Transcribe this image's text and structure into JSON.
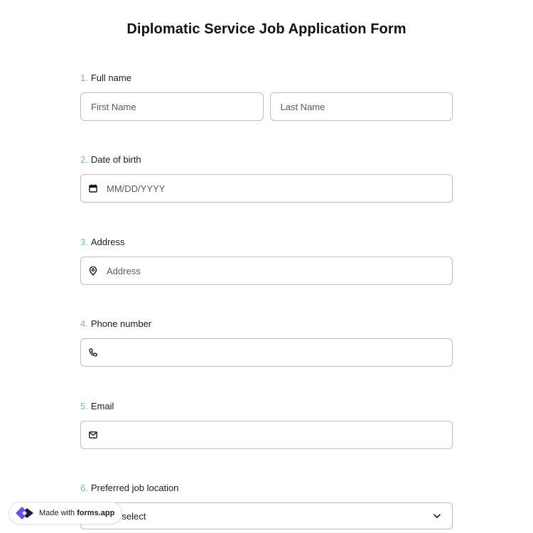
{
  "form": {
    "title": "Diplomatic Service Job Application Form"
  },
  "questions": [
    {
      "number": "1.",
      "label": "Full name",
      "fields": [
        {
          "placeholder": "First Name"
        },
        {
          "placeholder": "Last Name"
        }
      ]
    },
    {
      "number": "2.",
      "label": "Date of birth",
      "icon": "calendar-icon",
      "placeholder": "MM/DD/YYYY"
    },
    {
      "number": "3.",
      "label": "Address",
      "icon": "location-pin-icon",
      "placeholder": "Address"
    },
    {
      "number": "4.",
      "label": "Phone number",
      "icon": "phone-icon",
      "placeholder": ""
    },
    {
      "number": "5.",
      "label": "Email",
      "icon": "envelope-icon",
      "placeholder": ""
    },
    {
      "number": "6.",
      "label": "Preferred job location",
      "select_value": "Please select",
      "icon": "chevron-down-icon"
    }
  ],
  "badge": {
    "prefix": "Made with",
    "brand": "forms.app",
    "logo_icon": "forms-app-logo-icon"
  },
  "colors": {
    "question_number": "#7cbcb6",
    "border": "#bdbdbd",
    "logo_purple": "#6c4cf1",
    "logo_dark": "#1b1b3a"
  }
}
